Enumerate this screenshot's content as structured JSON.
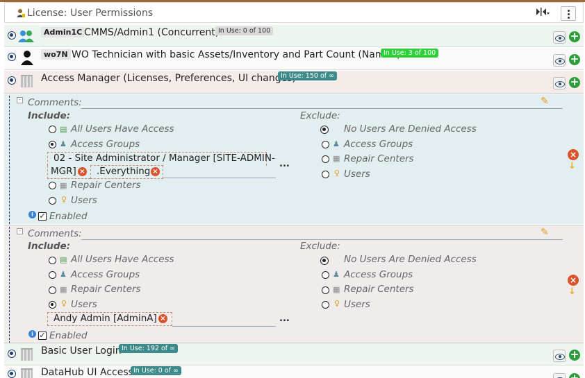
{
  "header": {
    "title": "License: User Permissions",
    "pin_icon": "column-toggle-icon",
    "menu_icon": "kebab-menu-icon"
  },
  "licenses": [
    {
      "code": "Admin1C",
      "name": "CMMS/Admin1 (Concurrent)",
      "badge": "In Use: 0 of 100",
      "badge_color": "#d9d9d9",
      "icon": "users-group-icon"
    },
    {
      "code": "wo7N",
      "name": "WO Technician with basic Assets/Inventory and Part Count (Named)",
      "badge": "In Use: 3 of 100",
      "badge_color": "#2fcf3a",
      "icon": "user-icon"
    },
    {
      "code": "",
      "name": "Access Manager (Licenses, Preferences, UI changes)",
      "badge": "In Use: 150 of ∞",
      "badge_color": "#3d8a8a",
      "icon": "building-icon"
    },
    {
      "code": "",
      "name": "Basic User Login",
      "badge": "In Use: 192 of ∞",
      "badge_color": "#3d8a8a",
      "icon": "building-icon"
    },
    {
      "code": "",
      "name": "DataHub UI Access",
      "badge": "In Use: 0 of ∞",
      "badge_color": "#3d8a8a",
      "icon": "building-icon"
    }
  ],
  "labels": {
    "comments": "Comments:",
    "include": "Include:",
    "exclude": "Exclude:",
    "all_users": "All Users Have Access",
    "access_groups": "Access Groups",
    "repair_centers": "Repair Centers",
    "users": "Users",
    "no_users_denied": "No Users Are Denied Access",
    "enabled": "Enabled",
    "more": "...",
    "remove": "×",
    "down_arrow": "↓"
  },
  "permission_sets": [
    {
      "include_selected": "access_groups",
      "exclude_selected": "no_users_denied",
      "chips": [
        "02 - Site Administrator / Manager [SITE-ADMIN-",
        "MGR]",
        ".Everything"
      ],
      "enabled": true
    },
    {
      "include_selected": "users",
      "exclude_selected": "no_users_denied",
      "chips": [
        "Andy Admin [AdminA]"
      ],
      "enabled": true
    }
  ],
  "colors": {
    "section1_bg": "#e3eef0",
    "section2_bg": "#f0ecec",
    "row_bg": "#eef4ee",
    "accent_brown": "#a06a3c"
  }
}
